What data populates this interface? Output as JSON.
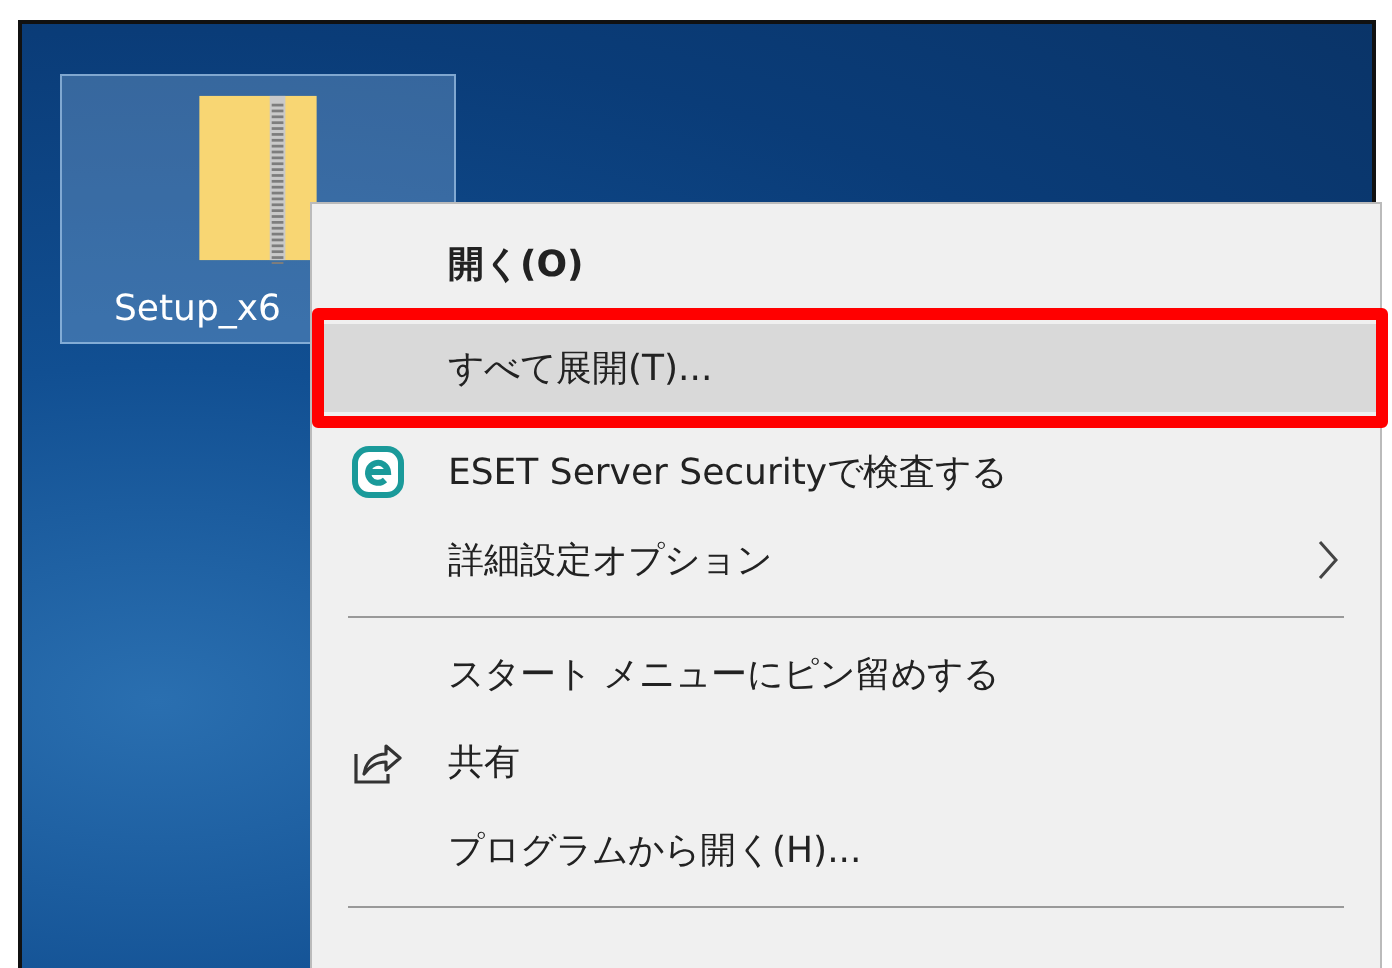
{
  "desktop_icon": {
    "label": "Setup_x6",
    "selected": true
  },
  "context_menu": {
    "items": [
      {
        "kind": "default",
        "label": "開く(O)",
        "selected": false,
        "annotated": false
      },
      {
        "kind": "plain",
        "label": "すべて展開(T)...",
        "selected": true,
        "annotated": true
      },
      {
        "kind": "eset",
        "label": "ESET Server Securityで検査する",
        "selected": false,
        "annotated": false
      },
      {
        "kind": "submenu",
        "label": "詳細設定オプション",
        "selected": false,
        "annotated": false
      },
      {
        "kind": "separator"
      },
      {
        "kind": "plain",
        "label": "スタート メニューにピン留めする",
        "selected": false,
        "annotated": false
      },
      {
        "kind": "share",
        "label": "共有",
        "selected": false,
        "annotated": false
      },
      {
        "kind": "plain",
        "label": "プログラムから開く(H)...",
        "selected": false,
        "annotated": false
      },
      {
        "kind": "separator"
      }
    ]
  }
}
